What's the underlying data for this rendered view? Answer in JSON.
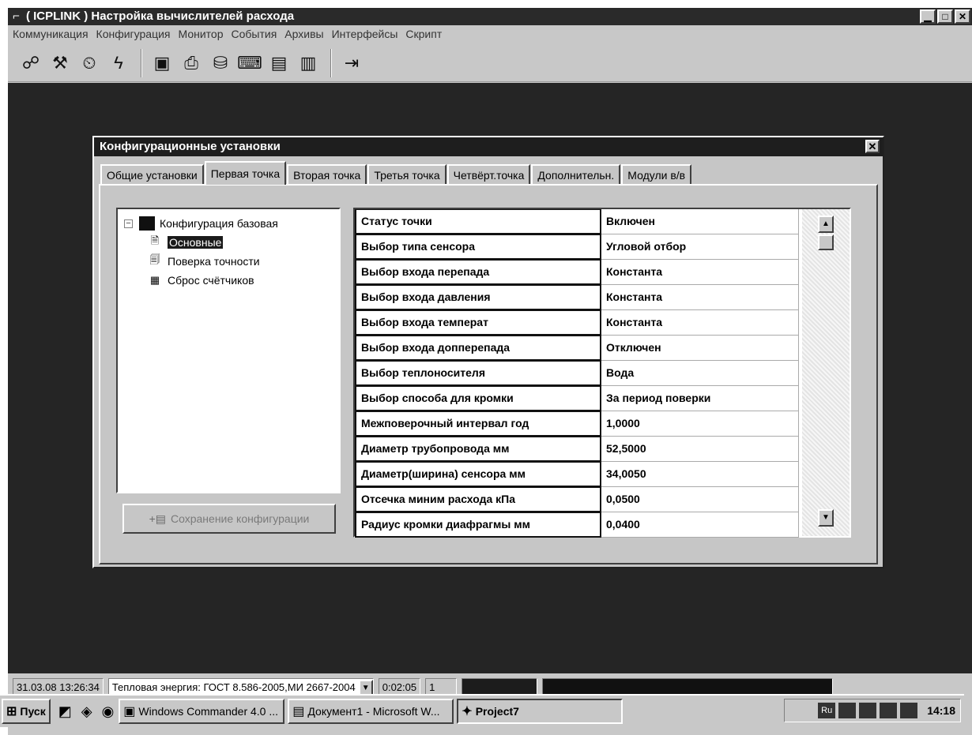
{
  "window": {
    "title": "( ICPLINK ) Настройка вычислителей расхода",
    "icon": "app-icon",
    "controls": [
      "minimize",
      "maximize",
      "close"
    ]
  },
  "menu": [
    "Коммуникация",
    "Конфигурация",
    "Монитор",
    "События",
    "Архивы",
    "Интерфейсы",
    "Скрипт"
  ],
  "toolbar": {
    "groups": [
      [
        "communication-icon",
        "tools-icon",
        "clock-icon",
        "lightning-icon"
      ],
      [
        "monitor-icon",
        "printer-icon",
        "database-icon",
        "computer-icon",
        "archive-icon",
        "archive-edit-icon"
      ],
      [
        "exit-icon"
      ]
    ]
  },
  "dialog": {
    "title": "Конфигурационные установки",
    "tabs": [
      {
        "label": "Общие установки",
        "active": false
      },
      {
        "label": "Первая точка",
        "active": true
      },
      {
        "label": "Вторая точка",
        "active": false
      },
      {
        "label": "Третья точка",
        "active": false
      },
      {
        "label": "Четвёрт.точка",
        "active": false
      },
      {
        "label": "Дополнительн.",
        "active": false
      },
      {
        "label": "Модули в/в",
        "active": false
      }
    ],
    "tree": {
      "root_label": "Конфигурация базовая",
      "root_toggle": "−",
      "children": [
        {
          "label": "Основные",
          "selected": true,
          "icon": "document-icon"
        },
        {
          "label": "Поверка точности",
          "selected": false,
          "icon": "check-document-icon"
        },
        {
          "label": "Сброс счётчиков",
          "selected": false,
          "icon": "counter-icon"
        }
      ]
    },
    "save_button": "Сохранение конфигурации",
    "properties": [
      {
        "key": "Статус точки",
        "value": "Включен"
      },
      {
        "key": "Выбор типа сенсора",
        "value": "Угловой отбор"
      },
      {
        "key": "Выбор входа перепада",
        "value": "Константа"
      },
      {
        "key": "Выбор входа давления",
        "value": "Константа"
      },
      {
        "key": "Выбор входа температ",
        "value": "Константа"
      },
      {
        "key": "Выбор входа допперепада",
        "value": "Отключен"
      },
      {
        "key": "Выбор теплоносителя",
        "value": "Вода"
      },
      {
        "key": "Выбор способа для кромки",
        "value": "За период поверки"
      },
      {
        "key": "Межповерочный интервал год",
        "value": "1,0000"
      },
      {
        "key": "Диаметр трубопровода мм",
        "value": "52,5000"
      },
      {
        "key": "Диаметр(ширина) сенсора мм",
        "value": "34,0050"
      },
      {
        "key": "Отсечка миним расхода кПа",
        "value": "0,0500"
      },
      {
        "key": "Радиус кромки диафрагмы мм",
        "value": "0,0400"
      }
    ]
  },
  "statusbar": {
    "datetime": "31.03.08 13:26:34",
    "standard": "Тепловая энергия: ГОСТ 8.586-2005,МИ 2667-2004",
    "timer": "0:02:05",
    "counter": "1"
  },
  "taskbar": {
    "start": "Пуск",
    "tasks": [
      {
        "label": "Windows Commander 4.0 ...",
        "icon": "floppy-icon"
      },
      {
        "label": "Документ1 - Microsoft W...",
        "icon": "word-icon"
      },
      {
        "label": "Project7",
        "icon": "vb-icon",
        "active": true
      }
    ],
    "tray_lang": "Ru",
    "clock": "14:18"
  },
  "colors": {
    "face": "#c8c8c8",
    "titlebar": "#2a2a2a",
    "mdi_background": "#252525",
    "selection": "#1a1a1a"
  }
}
